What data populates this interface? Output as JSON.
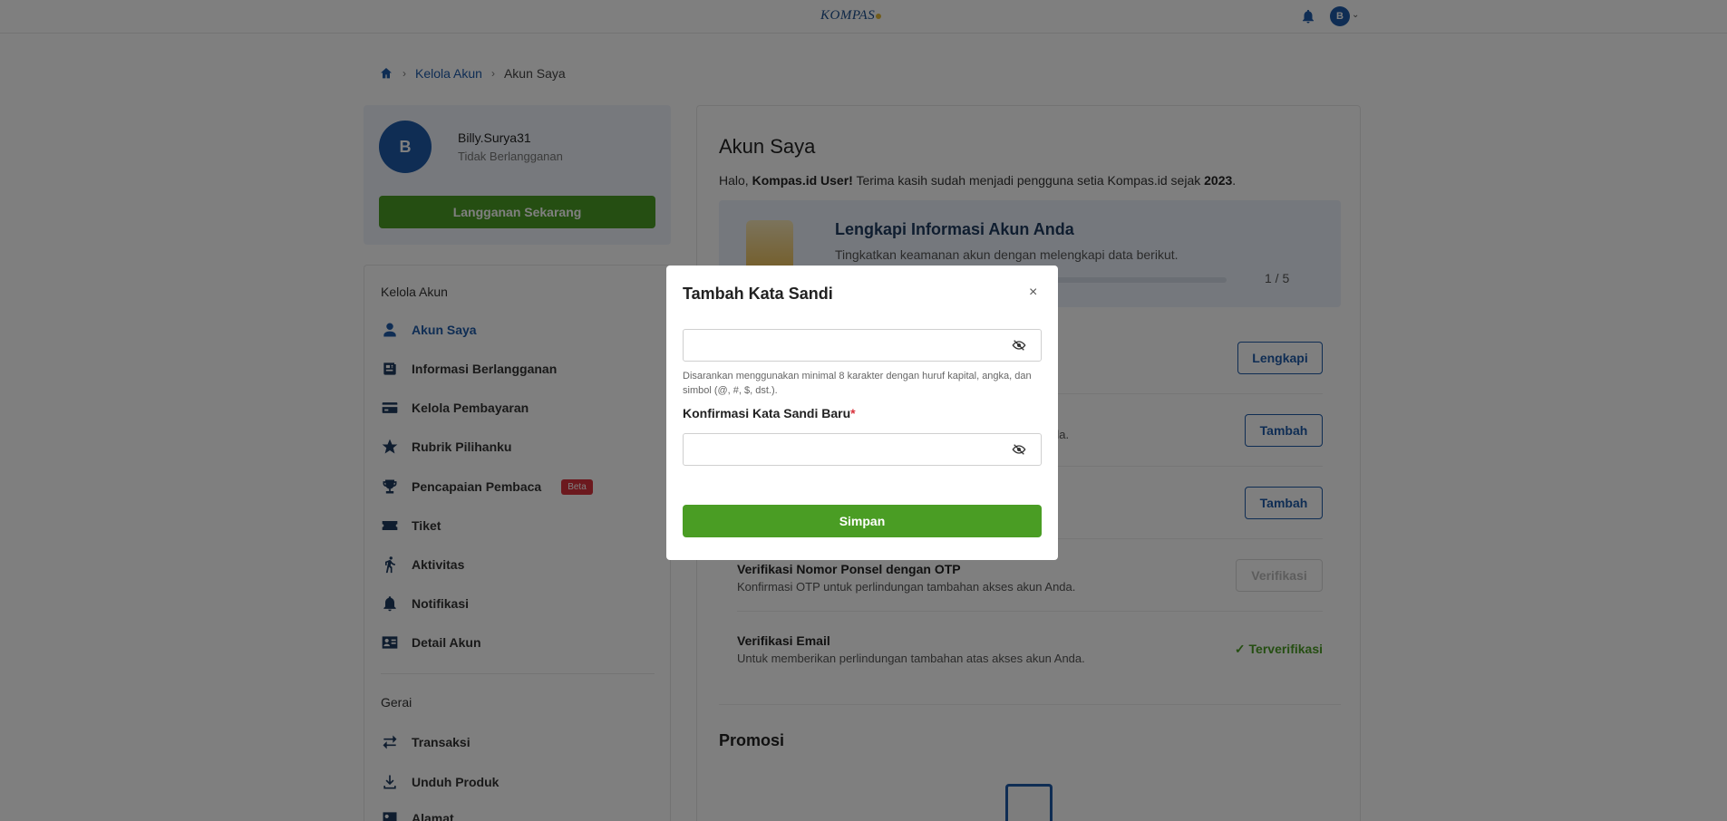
{
  "header": {
    "logo_text": "KOMPAS",
    "avatar_initial": "B"
  },
  "breadcrumb": {
    "items": [
      "Kelola Akun",
      "Akun Saya"
    ]
  },
  "profile": {
    "initial": "B",
    "username": "Billy.Surya31",
    "status": "Tidak Berlangganan",
    "subscribe_label": "Langganan Sekarang"
  },
  "sidebar": {
    "section_account": "Kelola Akun",
    "items": [
      {
        "label": "Akun Saya",
        "icon": "user-icon"
      },
      {
        "label": "Informasi Berlangganan",
        "icon": "newspaper-icon"
      },
      {
        "label": "Kelola Pembayaran",
        "icon": "credit-card-icon"
      },
      {
        "label": "Rubrik Pilihanku",
        "icon": "star-icon"
      },
      {
        "label": "Pencapaian Pembaca",
        "icon": "trophy-icon",
        "badge": "Beta"
      },
      {
        "label": "Tiket",
        "icon": "ticket-icon"
      },
      {
        "label": "Aktivitas",
        "icon": "running-icon"
      },
      {
        "label": "Notifikasi",
        "icon": "bell-icon"
      },
      {
        "label": "Detail Akun",
        "icon": "id-card-icon"
      }
    ],
    "section_store": "Gerai",
    "store_items": [
      {
        "label": "Transaksi",
        "icon": "transfer-icon"
      },
      {
        "label": "Unduh Produk",
        "icon": "download-icon"
      },
      {
        "label": "Alamat",
        "icon": "address-icon"
      }
    ]
  },
  "main": {
    "title": "Akun Saya",
    "greeting_prefix": "Halo, ",
    "greeting_name": "Kompas.id User!",
    "greeting_mid": " Terima kasih sudah menjadi pengguna setia Kompas.id sejak ",
    "greeting_year": "2023",
    "greeting_end": ".",
    "complete_title": "Lengkapi Informasi Akun Anda",
    "complete_sub": "Tingkatkan keamanan akun dengan melengkapi data berikut.",
    "progress_text": "1 / 5",
    "progress_fraction": 0.2,
    "rows": [
      {
        "button": "Lengkapi"
      },
      {
        "desc": "da.",
        "button": "Tambah"
      },
      {
        "button": "Tambah"
      },
      {
        "title": "Verifikasi Nomor Ponsel dengan OTP",
        "desc": "Konfirmasi OTP untuk perlindungan tambahan akses akun Anda.",
        "button": "Verifikasi"
      },
      {
        "title": "Verifikasi Email",
        "desc": "Untuk memberikan perlindungan tambahan atas akses akun Anda.",
        "status": "Terverifikasi"
      }
    ],
    "promo_title": "Promosi"
  },
  "modal": {
    "title": "Tambah Kata Sandi",
    "close_symbol": "×",
    "password_value": "",
    "hint": "Disarankan menggunakan minimal 8 karakter dengan huruf kapital, angka, dan simbol (@, #, $, dst.).",
    "confirm_label": "Konfirmasi Kata Sandi Baru",
    "required_mark": "*",
    "confirm_value": "",
    "save_label": "Simpan"
  },
  "colors": {
    "brand_blue": "#1e5aa8",
    "accent_green": "#4a9d24",
    "beta_red": "#d8333d"
  }
}
